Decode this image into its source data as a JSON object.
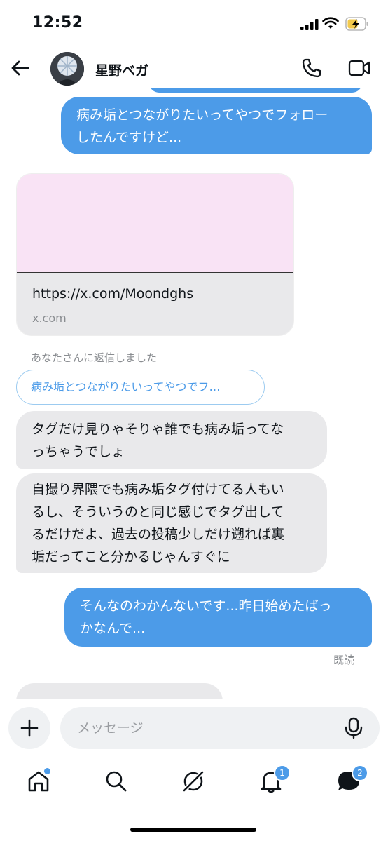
{
  "status": {
    "time": "12:52"
  },
  "header": {
    "name": "星野ベガ"
  },
  "messages": {
    "sent_1": [
      "病み垢とつながりたいってやつでフォロー",
      "したんですけど..."
    ],
    "link_card": {
      "url": "https://x.com/Moondghs",
      "domain": "x.com"
    },
    "reply_label": "あなたさんに返信しました",
    "reply_quote": "病み垢とつながりたいってやつでフ…",
    "recv_1": [
      "タグだけ見りゃそりゃ誰でも病み垢ってな",
      "っちゃうでしょ"
    ],
    "recv_2": [
      "自撮り界隈でも病み垢タグ付けてる人もい",
      "るし、そういうのと同じ感じでタグ出して",
      "るだけだよ、過去の投稿少しだけ遡れば裏",
      "垢だってこと分かるじゃんすぐに"
    ],
    "sent_2": [
      "そんなのわかんないです...昨日始めたばっ",
      "かなんで..."
    ],
    "read_receipt": "既読"
  },
  "composer": {
    "placeholder": "メッセージ"
  },
  "nav": {
    "notifications_badge": "1",
    "messages_badge": "2"
  },
  "colors": {
    "accent": "#4c9be8",
    "received_bubble": "#e9e9eb",
    "link_preview": "#f9e3f5"
  }
}
